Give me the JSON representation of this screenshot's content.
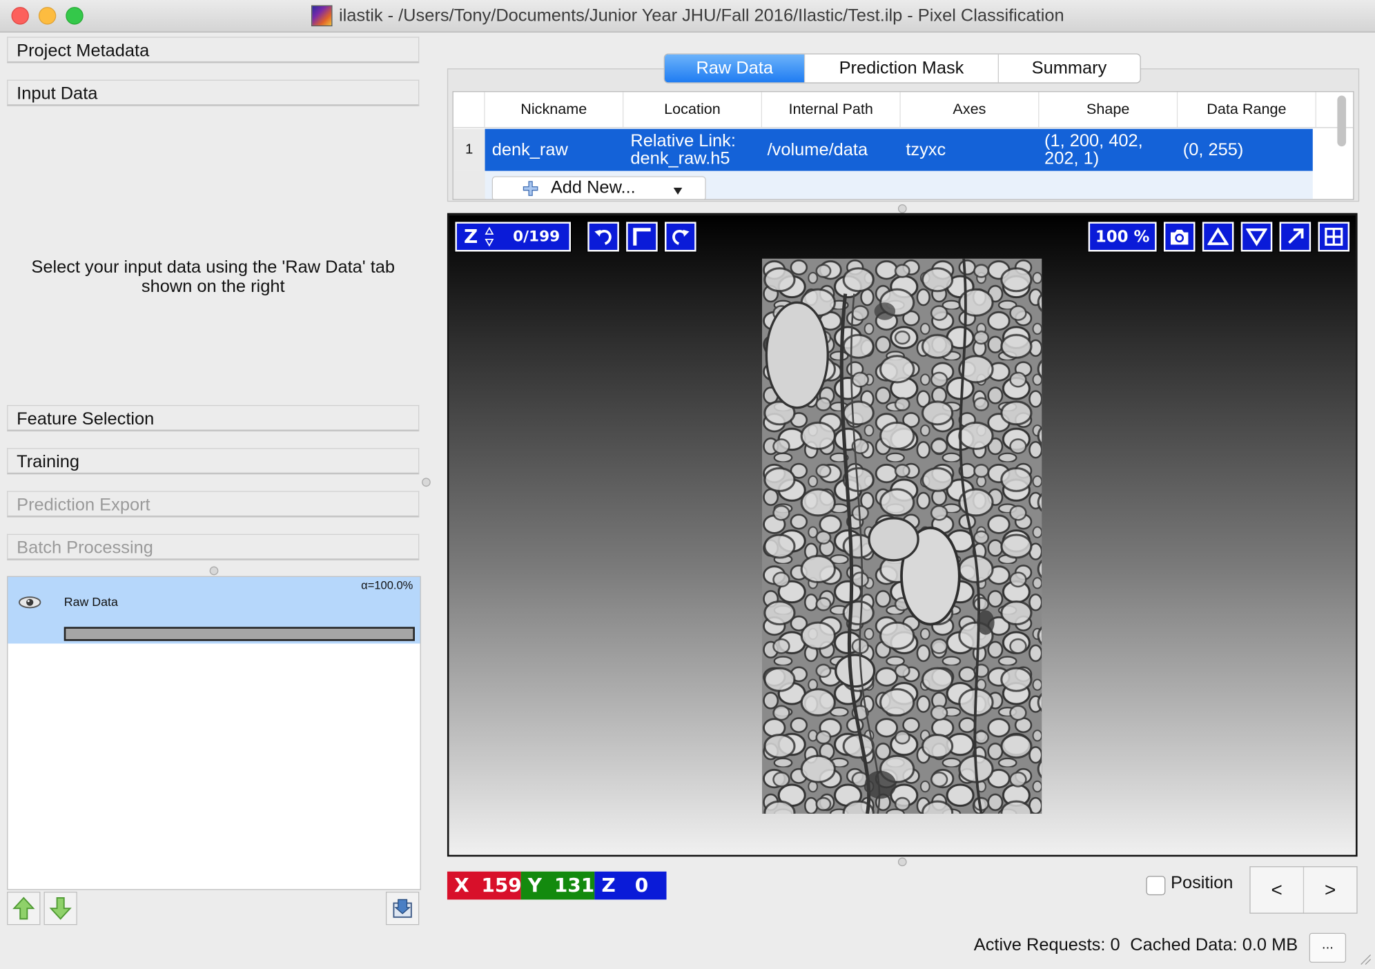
{
  "window": {
    "title": "ilastik - /Users/Tony/Documents/Junior Year JHU/Fall 2016/Ilastic/Test.ilp - Pixel Classification"
  },
  "applets": {
    "project_metadata": "Project Metadata",
    "input_data": "Input Data",
    "input_hint": "Select your input data using the 'Raw Data' tab shown on the right",
    "feature_selection": "Feature Selection",
    "training": "Training",
    "prediction_export": "Prediction Export",
    "batch_processing": "Batch Processing"
  },
  "layers": {
    "items": [
      {
        "name": "Raw Data",
        "alpha": "α=100.0%",
        "visible": true,
        "opacity": 1.0
      }
    ]
  },
  "tabs": [
    "Raw Data",
    "Prediction Mask",
    "Summary"
  ],
  "active_tab": "Raw Data",
  "dataset_table": {
    "headers": [
      "Nickname",
      "Location",
      "Internal Path",
      "Axes",
      "Shape",
      "Data Range"
    ],
    "rows": [
      {
        "index": "1",
        "nickname": "denk_raw",
        "location": "Relative Link: denk_raw.h5",
        "internal_path": "/volume/data",
        "axes": "tzyxc",
        "shape": "(1, 200, 402, 202, 1)",
        "data_range": "(0, 255)"
      }
    ],
    "add_new_label": "Add New..."
  },
  "viewer": {
    "axis_label": "Z",
    "slice": "0/199",
    "zoom": "100 %"
  },
  "coords": {
    "x_label": "X",
    "x": "159",
    "y_label": "Y",
    "y": "131",
    "z_label": "Z",
    "z": "0"
  },
  "position_label": "Position",
  "nav": {
    "prev": "<",
    "next": ">"
  },
  "status": {
    "active_requests": "Active Requests: 0",
    "cached_data": "Cached Data: 0.0 MB",
    "more": "..."
  },
  "colors": {
    "accent": "#1462d8",
    "viewer_button": "#0a1bd8",
    "x_box": "#d8102a",
    "y_box": "#138a0e",
    "z_box": "#0a1bd8",
    "layer_selected": "#b6d7fb"
  }
}
